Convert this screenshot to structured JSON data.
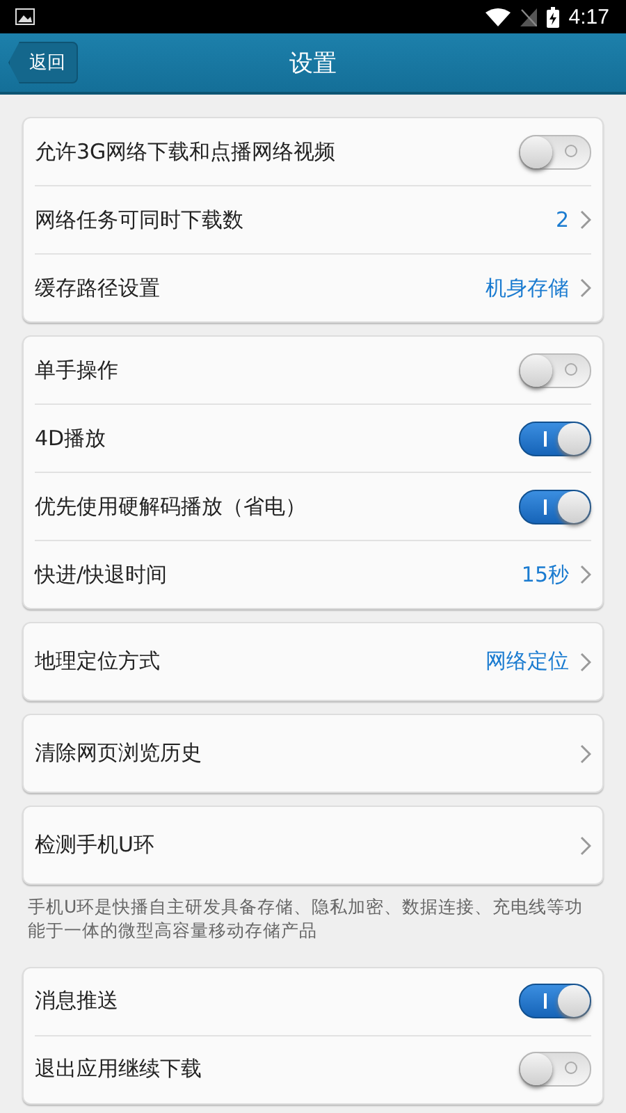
{
  "status_bar": {
    "time": "4:17"
  },
  "header": {
    "back": "返回",
    "title": "设置"
  },
  "sections": [
    {
      "kind": "card",
      "rows": [
        {
          "kind": "toggle",
          "label": "允许3G网络下载和点播网络视频",
          "on": false
        },
        {
          "kind": "link",
          "label": "网络任务可同时下载数",
          "value": "2"
        },
        {
          "kind": "link",
          "label": "缓存路径设置",
          "value": "机身存储"
        }
      ]
    },
    {
      "kind": "card",
      "rows": [
        {
          "kind": "toggle",
          "label": "单手操作",
          "on": false
        },
        {
          "kind": "toggle",
          "label": "4D播放",
          "on": true
        },
        {
          "kind": "toggle",
          "label": "优先使用硬解码播放（省电）",
          "on": true
        },
        {
          "kind": "link",
          "label": "快进/快退时间",
          "value": "15秒"
        }
      ]
    },
    {
      "kind": "card",
      "rows": [
        {
          "kind": "link",
          "label": "地理定位方式",
          "value": "网络定位"
        }
      ]
    },
    {
      "kind": "card",
      "rows": [
        {
          "kind": "link",
          "label": "清除网页浏览历史"
        }
      ]
    },
    {
      "kind": "card",
      "rows": [
        {
          "kind": "link",
          "label": "检测手机U环"
        }
      ]
    },
    {
      "kind": "note",
      "text": "手机U环是快播自主研发具备存储、隐私加密、数据连接、充电线等功能于一体的微型高容量移动存储产品"
    },
    {
      "kind": "card",
      "rows": [
        {
          "kind": "toggle",
          "label": "消息推送",
          "on": true
        },
        {
          "kind": "toggle",
          "label": "退出应用继续下载",
          "on": false
        }
      ]
    }
  ]
}
